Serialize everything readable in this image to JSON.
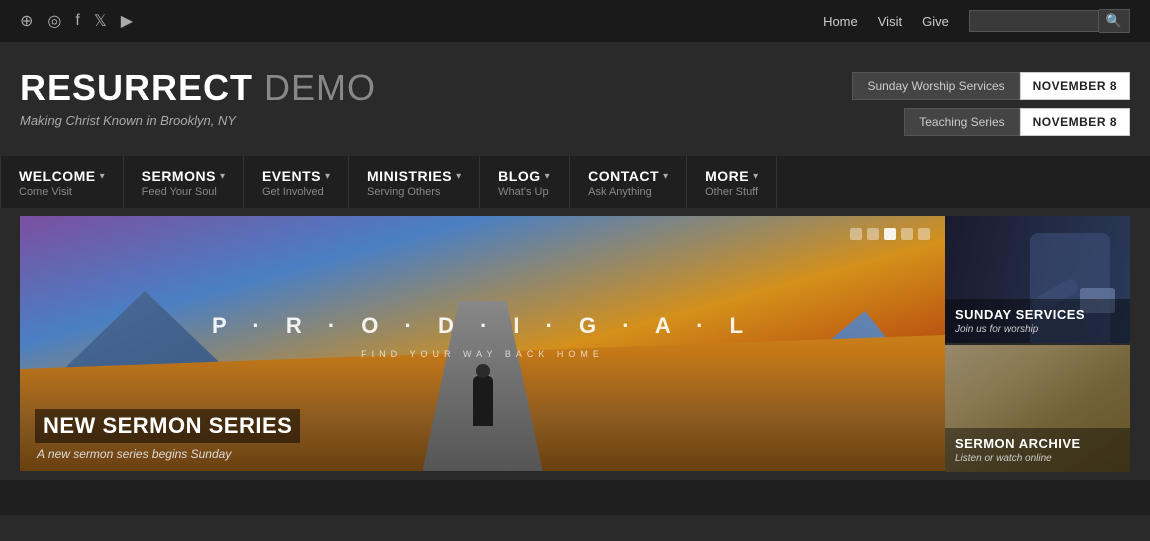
{
  "topbar": {
    "social": {
      "rss": "RSS",
      "podcast": "Podcast",
      "facebook": "Facebook",
      "twitter": "Twitter",
      "youtube": "YouTube"
    },
    "nav": {
      "home": "Home",
      "visit": "Visit",
      "give": "Give"
    },
    "search": {
      "placeholder": ""
    }
  },
  "header": {
    "logo_main": "RESURRECT",
    "logo_demo": " DEMO",
    "tagline": "Making Christ Known in Brooklyn, NY",
    "badges": [
      {
        "label": "Sunday Worship Services",
        "date": "NOVEMBER 8"
      },
      {
        "label": "Teaching Series",
        "date": "NOVEMBER 8"
      }
    ]
  },
  "nav": {
    "items": [
      {
        "main": "WELCOME",
        "sub": "Come Visit",
        "arrow": "▾"
      },
      {
        "main": "SERMONS",
        "sub": "Feed Your Soul",
        "arrow": "▾"
      },
      {
        "main": "EVENTS",
        "sub": "Get Involved",
        "arrow": "▾"
      },
      {
        "main": "MINISTRIES",
        "sub": "Serving Others",
        "arrow": "▾"
      },
      {
        "main": "BLOG",
        "sub": "What's Up",
        "arrow": "▾"
      },
      {
        "main": "CONTACT",
        "sub": "Ask Anything",
        "arrow": "▾"
      },
      {
        "main": "MORE",
        "sub": "Other Stuff",
        "arrow": "▾"
      }
    ]
  },
  "hero": {
    "title_word": "P · R · O · D · I · G · A · L",
    "subtitle": "FIND YOUR WAY BACK HOME",
    "caption_title": "NEW SERMON SERIES",
    "caption_desc": "A new sermon series begins Sunday",
    "dots": [
      false,
      false,
      true,
      false,
      false
    ]
  },
  "panels": {
    "sunday": {
      "title": "SUNDAY SERVICES",
      "sub": "Join us for worship"
    },
    "archive": {
      "title": "SERMON ARCHIVE",
      "sub": "Listen or watch online"
    }
  }
}
